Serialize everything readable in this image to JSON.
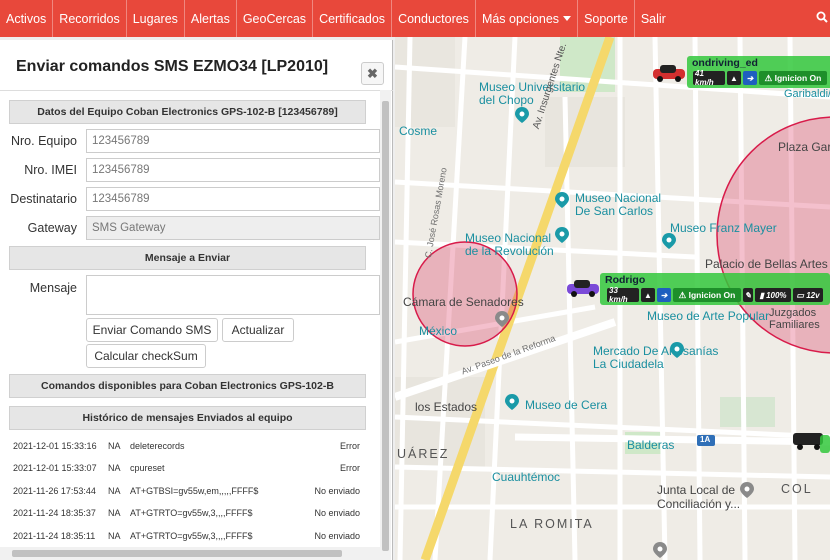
{
  "nav": {
    "items": [
      "Activos",
      "Recorridos",
      "Lugares",
      "Alertas",
      "GeoCercas",
      "Certificados",
      "Conductores"
    ],
    "more_label": "Más opciones",
    "support_label": "Soporte",
    "logout_label": "Salir",
    "search_icon": "search-icon"
  },
  "dialog": {
    "title": "Enviar comandos SMS EZMO34 [LP2010]",
    "close_glyph": "✖",
    "section_equipment": "Datos del Equipo Coban Electronics GPS-102-B [123456789]",
    "fields": {
      "equipo_label": "Nro. Equipo",
      "equipo_value": "123456789",
      "imei_label": "Nro. IMEI",
      "imei_value": "123456789",
      "dest_label": "Destinatario",
      "dest_value": "123456789",
      "gateway_label": "Gateway",
      "gateway_value": "SMS Gateway"
    },
    "section_message": "Mensaje a Enviar",
    "message_label": "Mensaje",
    "message_value": "",
    "buttons": {
      "send": "Enviar Comando SMS",
      "update": "Actualizar",
      "checksum": "Calcular checkSum"
    },
    "section_commands": "Comandos disponibles para Coban Electronics GPS-102-B",
    "section_history": "Histórico de mensajes Enviados al equipo",
    "history": [
      {
        "date": "2021-12-01 15:33:16",
        "na": "NA",
        "command": "deleterecords",
        "status": "Error"
      },
      {
        "date": "2021-12-01 15:33:07",
        "na": "NA",
        "command": "cpureset",
        "status": "Error"
      },
      {
        "date": "2021-11-26 17:53:44",
        "na": "NA",
        "command": "AT+GTBSI=gv55w,em,,,,,FFFF$",
        "status": "No enviado"
      },
      {
        "date": "2021-11-24 18:35:37",
        "na": "NA",
        "command": "AT+GTRTO=gv55w,3,,,,FFFF$",
        "status": "No enviado"
      },
      {
        "date": "2021-11-24 18:35:11",
        "na": "NA",
        "command": "AT+GTRTO=gv55w,3,,,,FFFF$",
        "status": "No enviado"
      }
    ]
  },
  "map": {
    "labels": {
      "museo_universitario": "Museo Universitario\ndel Chopo",
      "cosme": "Cosme",
      "insurgentes": "Av. Insurgentes Nte.",
      "rosas_moreno": "C. José Rosas Moreno",
      "san_carlos": "Museo Nacional\nDe San Carlos",
      "franz_mayer": "Museo Franz Mayer",
      "revolucion": "Museo Nacional\nde la Revolución",
      "bellas_artes": "Palacio de Bellas Artes",
      "senadores": "Cámara de Senadores",
      "mexico": "México",
      "reforma": "Av. Paseo de la Reforma",
      "arte_popular": "Museo de Arte Popular",
      "juzgados": "Juzgados\nFamiliares",
      "artesanias": "Mercado De Artesanías\nLa Ciudadela",
      "cera": "Museo de Cera",
      "estados": "los Estados",
      "juarez": "UÁREZ",
      "balderas": "Balderas",
      "cuauhtemoc": "Cuauhtémoc",
      "junta": "Junta Local de\nConciliación y...",
      "romita": "LA ROMITA",
      "col": "COL",
      "plaza_gar": "Plaza Gar",
      "garibaldi": "Garibaldi/La",
      "highway": "1A"
    },
    "vehicles": [
      {
        "name": "ondriving_ed",
        "speed": "41 km/h",
        "ignition": "Ignicion On"
      },
      {
        "name": "Rodrigo",
        "speed": "33 km/h",
        "ignition": "Ignicion On",
        "battery": "100%",
        "voltage": "12v"
      }
    ]
  },
  "colors": {
    "nav": "#e8483b",
    "geofence": "#d81b4a",
    "vehicle_box": "#32c83c",
    "road_main": "#f5d86b",
    "place_label": "#1a8fa0"
  }
}
